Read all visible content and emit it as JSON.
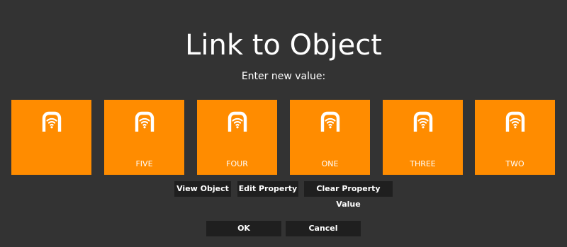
{
  "dialog": {
    "title": "Link to Object",
    "prompt": "Enter new value:"
  },
  "tiles": [
    {
      "label": "",
      "icon": "object-link-icon"
    },
    {
      "label": "FIVE",
      "icon": "object-link-icon"
    },
    {
      "label": "FOUR",
      "icon": "object-link-icon"
    },
    {
      "label": "ONE",
      "icon": "object-link-icon"
    },
    {
      "label": "THREE",
      "icon": "object-link-icon"
    },
    {
      "label": "TWO",
      "icon": "object-link-icon"
    }
  ],
  "actions": {
    "view_object": "View Object",
    "edit_property": "Edit Property",
    "clear_property_value": "Clear Property Value"
  },
  "footer": {
    "ok": "OK",
    "cancel": "Cancel"
  },
  "colors": {
    "background": "#333333",
    "tile": "#ff8c00",
    "button": "#1f1f1f",
    "text": "#ffffff"
  }
}
